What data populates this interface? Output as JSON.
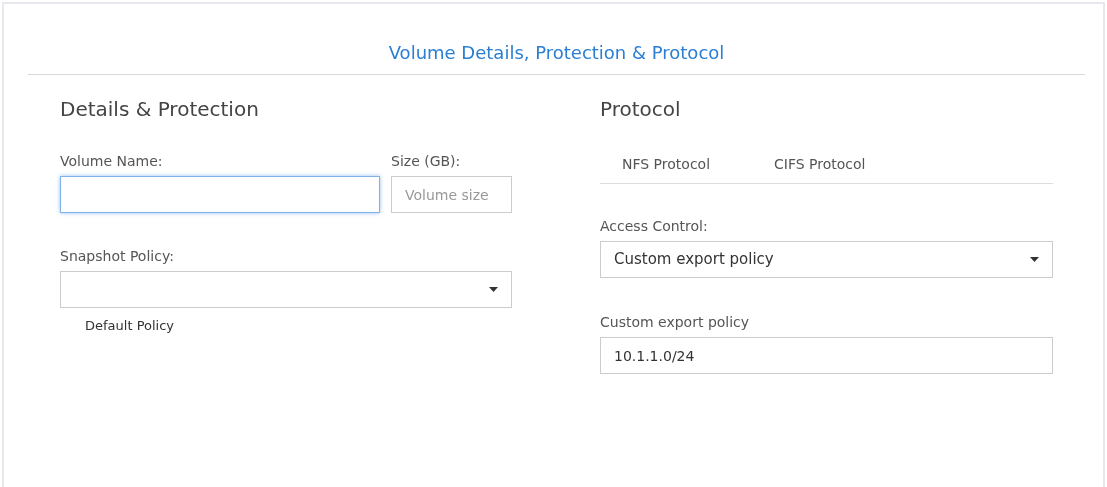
{
  "title": "Volume Details, Protection & Protocol",
  "details": {
    "heading": "Details & Protection",
    "volume_name": {
      "label": "Volume Name:",
      "focused": true
    },
    "size": {
      "label": "Size (GB):",
      "placeholder": "Volume size"
    },
    "snapshot_policy": {
      "label": "Snapshot Policy:",
      "note": "Default Policy"
    }
  },
  "protocol": {
    "heading": "Protocol",
    "tabs": [
      {
        "label": "NFS Protocol"
      },
      {
        "label": "CIFS Protocol"
      }
    ],
    "access_control": {
      "label": "Access Control:",
      "value": "Custom export policy"
    },
    "custom_export_policy": {
      "label": "Custom export policy",
      "value": "10.1.1.0/24"
    }
  }
}
